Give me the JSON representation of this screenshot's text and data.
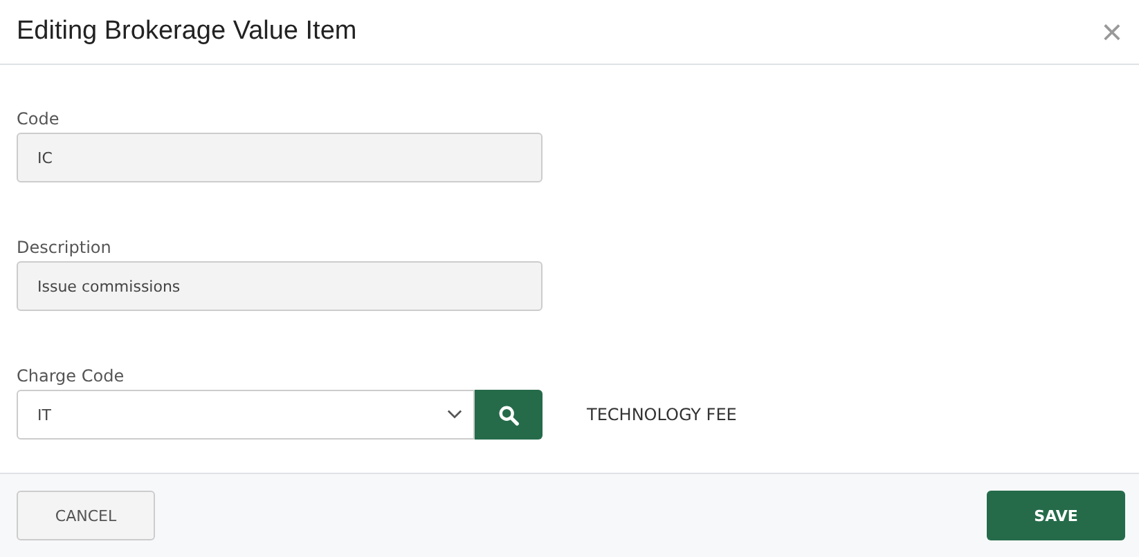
{
  "dialog": {
    "title": "Editing Brokerage Value Item",
    "close": "×"
  },
  "fields": [
    {
      "kind": "text",
      "label": "Code",
      "value": "IC",
      "disabled": true
    },
    {
      "kind": "text",
      "label": "Description",
      "value": "Issue commissions",
      "disabled": true
    },
    {
      "kind": "lookup",
      "label": "Charge Code",
      "value": "IT",
      "disabled": false,
      "note": "TECHNOLOGY FEE"
    }
  ],
  "buttons": [
    {
      "label": "CANCEL",
      "kind": "secondary"
    },
    {
      "label": "SAVE",
      "kind": "primary"
    }
  ]
}
